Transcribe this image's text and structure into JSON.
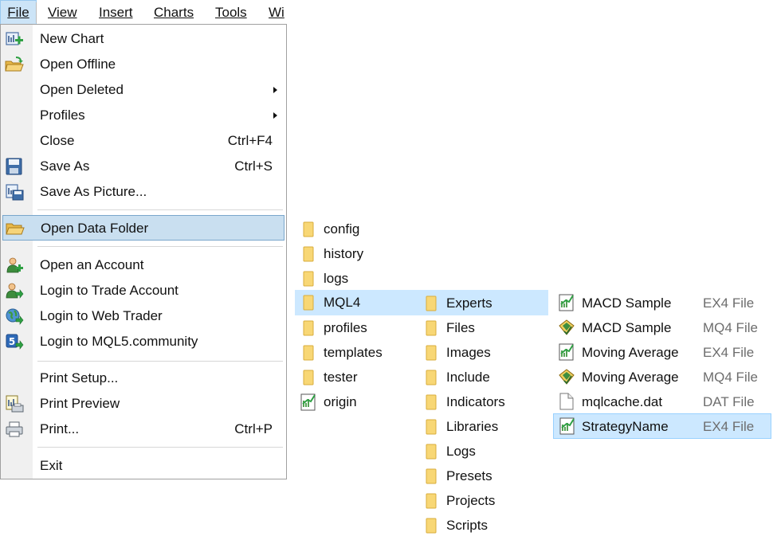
{
  "menubar": {
    "items": [
      "File",
      "View",
      "Insert",
      "Charts",
      "Tools",
      "Wi"
    ]
  },
  "file_menu": {
    "items": [
      {
        "label": "New Chart",
        "icon": "new-chart-icon"
      },
      {
        "label": "Open Offline",
        "icon": "open-offline-icon"
      },
      {
        "label": "Open Deleted",
        "submenu": true
      },
      {
        "label": "Profiles",
        "submenu": true
      },
      {
        "label": "Close",
        "shortcut": "Ctrl+F4"
      },
      {
        "label": "Save As",
        "shortcut": "Ctrl+S",
        "icon": "save-icon"
      },
      {
        "label": "Save As Picture...",
        "icon": "save-picture-icon"
      },
      {
        "label": "Open Data Folder",
        "icon": "folder-open-icon",
        "highlighted": true
      },
      {
        "label": "Open an Account",
        "icon": "account-icon"
      },
      {
        "label": "Login to Trade Account",
        "icon": "login-icon"
      },
      {
        "label": "Login to Web Trader",
        "icon": "globe-icon"
      },
      {
        "label": "Login to MQL5.community",
        "icon": "mql5-icon"
      },
      {
        "label": "Print Setup..."
      },
      {
        "label": "Print Preview",
        "icon": "print-preview-icon"
      },
      {
        "label": "Print...",
        "shortcut": "Ctrl+P",
        "icon": "printer-icon"
      },
      {
        "label": "Exit"
      }
    ]
  },
  "data_folder": {
    "items": [
      {
        "name": "config",
        "icon": "folder-icon"
      },
      {
        "name": "history",
        "icon": "folder-icon"
      },
      {
        "name": "logs",
        "icon": "folder-icon"
      },
      {
        "name": "MQL4",
        "icon": "folder-icon",
        "selected": true
      },
      {
        "name": "profiles",
        "icon": "folder-icon"
      },
      {
        "name": "templates",
        "icon": "folder-icon"
      },
      {
        "name": "tester",
        "icon": "folder-icon"
      },
      {
        "name": "origin",
        "icon": "ex4-file-icon"
      }
    ]
  },
  "mql4_folder": {
    "items": [
      {
        "name": "Experts",
        "selected": true
      },
      {
        "name": "Files"
      },
      {
        "name": "Images"
      },
      {
        "name": "Include"
      },
      {
        "name": "Indicators"
      },
      {
        "name": "Libraries"
      },
      {
        "name": "Logs"
      },
      {
        "name": "Presets"
      },
      {
        "name": "Projects"
      },
      {
        "name": "Scripts"
      }
    ]
  },
  "experts_folder": {
    "items": [
      {
        "name": "MACD Sample",
        "type": "EX4 File",
        "icon": "ex4-file-icon"
      },
      {
        "name": "MACD Sample",
        "type": "MQ4 File",
        "icon": "mq4-file-icon"
      },
      {
        "name": "Moving Average",
        "type": "EX4 File",
        "icon": "ex4-file-icon"
      },
      {
        "name": "Moving Average",
        "type": "MQ4 File",
        "icon": "mq4-file-icon"
      },
      {
        "name": "mqlcache.dat",
        "type": "DAT File",
        "icon": "blank-file-icon"
      },
      {
        "name": "StrategyName",
        "type": "EX4 File",
        "icon": "ex4-file-icon",
        "selected": true
      }
    ]
  },
  "colors": {
    "menu_highlight": "#c9dff0",
    "explorer_selection": "#cce8ff",
    "folder_yellow": "#f8d775",
    "gutter": "#f0f0f0"
  }
}
